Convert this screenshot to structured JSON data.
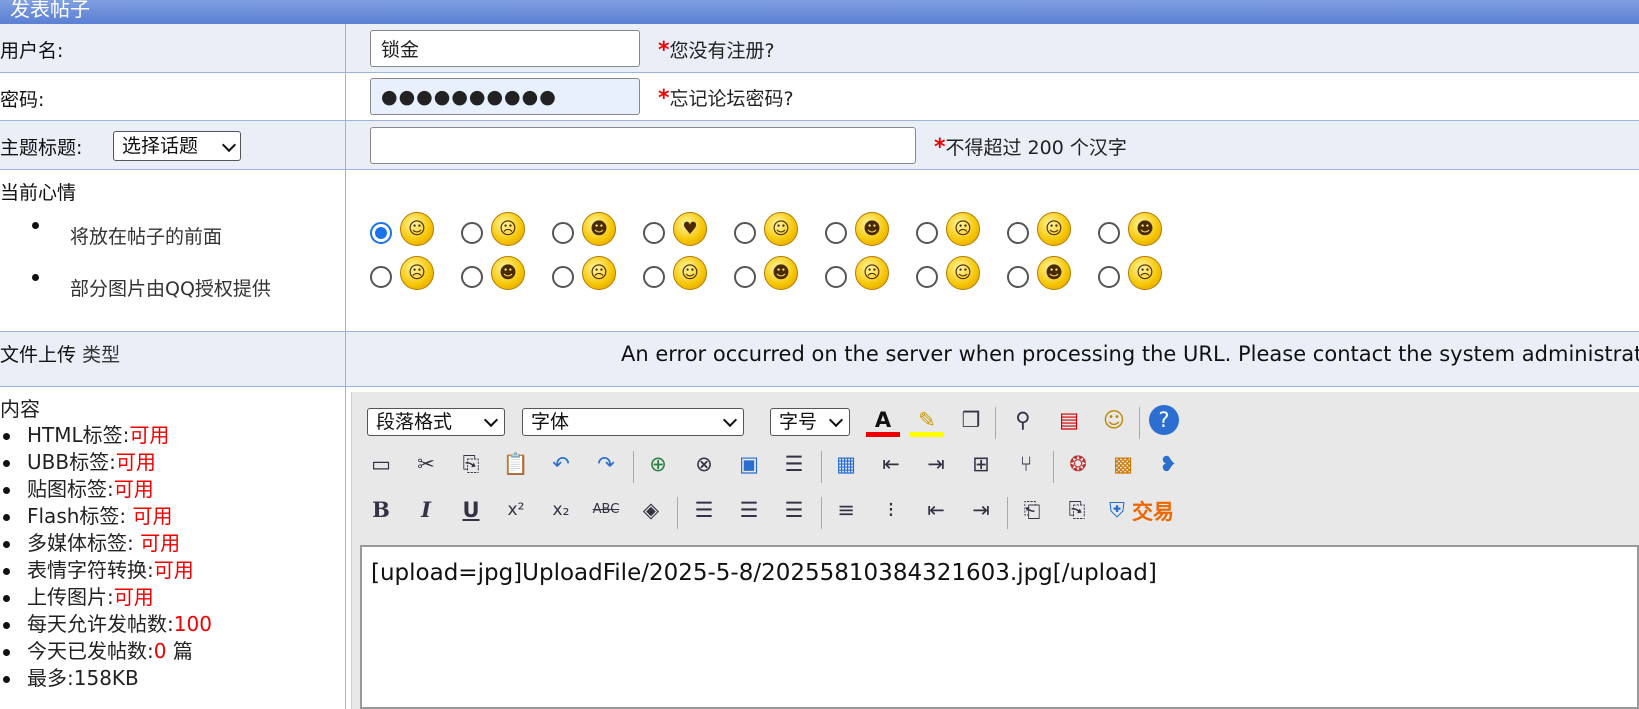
{
  "title": "发表帖子",
  "username": {
    "label": "用户名:",
    "value": "锁金",
    "hint": "您没有注册?"
  },
  "password": {
    "label": "密码:",
    "value": "●●●●●●●●●●",
    "hint": "忘记论坛密码?"
  },
  "subject": {
    "label": "主题标题:",
    "topic_select": "选择话题",
    "value": "",
    "hint": "不得超过 200 个汉字"
  },
  "mood": {
    "label": "当前心情",
    "notes": [
      "将放在帖子的前面",
      "部分图片由QQ授权提供"
    ],
    "icons": [
      "☺",
      "☹",
      "☻",
      "♥",
      "☺",
      "☻",
      "☹",
      "☺",
      "☻",
      "☹",
      "☻",
      "☹",
      "☺",
      "☻",
      "☹",
      "☺",
      "☻",
      "☹"
    ],
    "selected": 0
  },
  "upload": {
    "label": "文件上传",
    "type_label": "类型",
    "error": "An error occurred on the server when processing the URL. Please contact the system administrator."
  },
  "content": {
    "label": "内容",
    "items": [
      {
        "name": "HTML标签:",
        "value": "可用"
      },
      {
        "name": "UBB标签:",
        "value": "可用"
      },
      {
        "name": "贴图标签:",
        "value": "可用"
      },
      {
        "name": "Flash标签: ",
        "value": "可用"
      },
      {
        "name": "多媒体标签: ",
        "value": "可用"
      },
      {
        "name": "表情字符转换:",
        "value": "可用"
      },
      {
        "name": "上传图片:",
        "value": "可用"
      },
      {
        "name": "每天允许发帖数:",
        "value": "100"
      },
      {
        "name": "今天已发帖数:",
        "value": "0",
        "suffix": " 篇"
      },
      {
        "name": "最多:",
        "value": "158KB",
        "plain": true
      }
    ]
  },
  "editor": {
    "paragraph_format": "段落格式",
    "font": "字体",
    "font_size": "字号",
    "body": "[upload=jpg]UploadFile/2025-5-8/20255810384321603.jpg[/upload]"
  },
  "colors": {
    "accent_red": "#ee0000",
    "row_shade": "#e9eef7",
    "border": "#9bb3e0",
    "title_bar": "#5b7fd3"
  }
}
